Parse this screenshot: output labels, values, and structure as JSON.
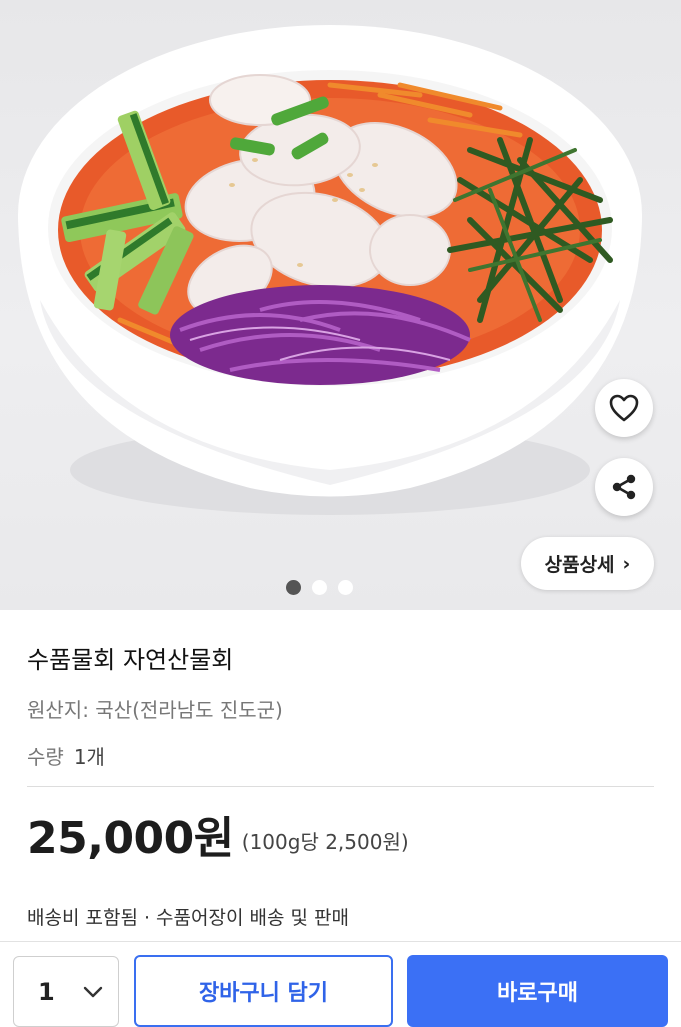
{
  "product": {
    "title": "수품물회 자연산물회",
    "origin": "원산지: 국산(전라남도 진도군)",
    "quantity_label": "수량",
    "quantity_value": "1개",
    "price": "25,000원",
    "unit_price": "(100g당 2,500원)",
    "shipping": "배송비 포함됨 · 수품어장이 배송 및 판매"
  },
  "hero": {
    "detail_button_label": "상품상세",
    "detail_button_arrow": "›",
    "carousel_total": 3,
    "carousel_active": 1,
    "icons": [
      "heart-icon",
      "share-icon"
    ]
  },
  "bottom_bar": {
    "quantity": "1",
    "cart_label": "장바구니 담기",
    "buy_label": "바로구매"
  },
  "colors": {
    "primary": "#3b70f5",
    "primary_text": "#2f63e8"
  }
}
